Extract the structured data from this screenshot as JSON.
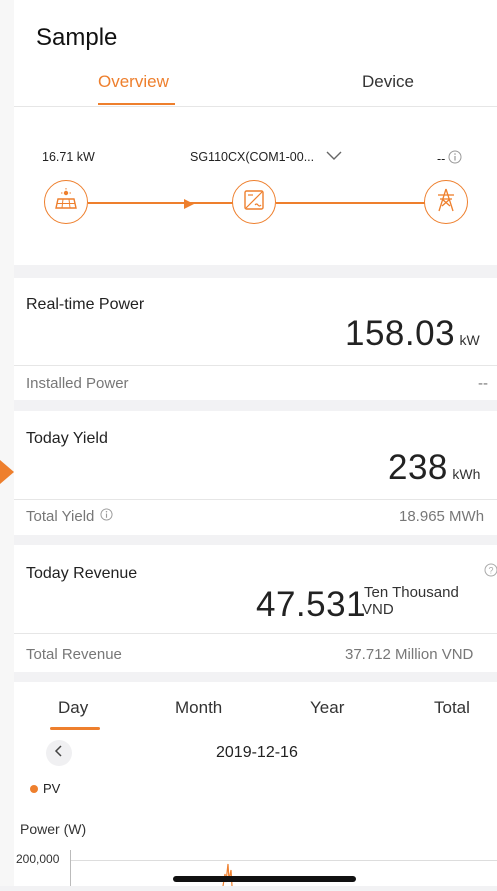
{
  "header": {
    "title": "Sample"
  },
  "tabs": [
    {
      "label": "Overview"
    },
    {
      "label": "Device"
    }
  ],
  "flow": {
    "pv_power": "16.71 kW",
    "device_selector": "SG110CX(COM1-00...",
    "grid_value": "--",
    "icons": [
      "solar-panel-icon",
      "inverter-icon",
      "grid-tower-icon"
    ]
  },
  "realtime": {
    "label": "Real-time Power",
    "value": "158.03",
    "unit": "kW",
    "installed_label": "Installed Power",
    "installed_value": "--"
  },
  "yield": {
    "today_label": "Today Yield",
    "today_value": "238",
    "today_unit": "kWh",
    "total_label": "Total Yield",
    "total_value": "18.965 MWh"
  },
  "revenue": {
    "today_label": "Today Revenue",
    "today_value": "47.531",
    "unit_line1": "Ten Thousand",
    "unit_line2": "VND",
    "total_label": "Total Revenue",
    "total_value": "37.712 Million VND"
  },
  "periods": [
    {
      "label": "Day"
    },
    {
      "label": "Month"
    },
    {
      "label": "Year"
    },
    {
      "label": "Total"
    }
  ],
  "date_nav": {
    "date": "2019-12-16"
  },
  "chart": {
    "legend": "PV",
    "y_title": "Power (W)",
    "y_tick": "200,000"
  },
  "colors": {
    "accent": "#ee7f2d"
  }
}
